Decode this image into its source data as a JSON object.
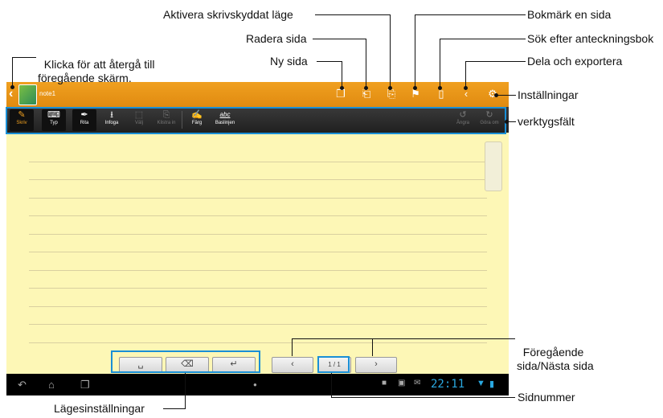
{
  "callouts": {
    "back": "Klicka för att återgå till\nföregående skärm.",
    "new_page": "Ny sida",
    "delete_page": "Radera sida",
    "read_only": "Aktivera skrivskyddat läge",
    "bookmark": "Bokmärk en sida",
    "search_notebook": "Sök efter anteckningsbok",
    "share_export": "Dela och exportera",
    "settings": "Inställningar",
    "toolbar": "verktygsfält",
    "prev_next": "Föregående\nsida/Nästa sida",
    "page_number": "Sidnummer",
    "mode_settings": "Lägesinställningar"
  },
  "app": {
    "note_title": "note1",
    "header_icons": [
      "new-page-icon",
      "delete-page-icon",
      "read-only-icon",
      "bookmark-icon",
      "notebook-icon",
      "share-icon",
      "gear-icon"
    ],
    "tools": {
      "write": "Skriv",
      "type": "Typ",
      "draw": "Rita",
      "insert": "Infoga",
      "select": "Välj",
      "paste": "Klistra in",
      "color": "Färg",
      "baseline": "Baslinjen",
      "baseline_icon_text": "abc",
      "undo": "Ångra",
      "redo": "Göra om"
    },
    "page_indicator": {
      "current": "1",
      "sep": "/",
      "total": "1"
    },
    "status": {
      "time": "22:11"
    }
  },
  "colors": {
    "header": "#e8951a",
    "toolbar": "#2a2a2a",
    "paper": "#fdf7b6",
    "callout_box": "#1a8fd6",
    "clock": "#2aa8e0"
  }
}
